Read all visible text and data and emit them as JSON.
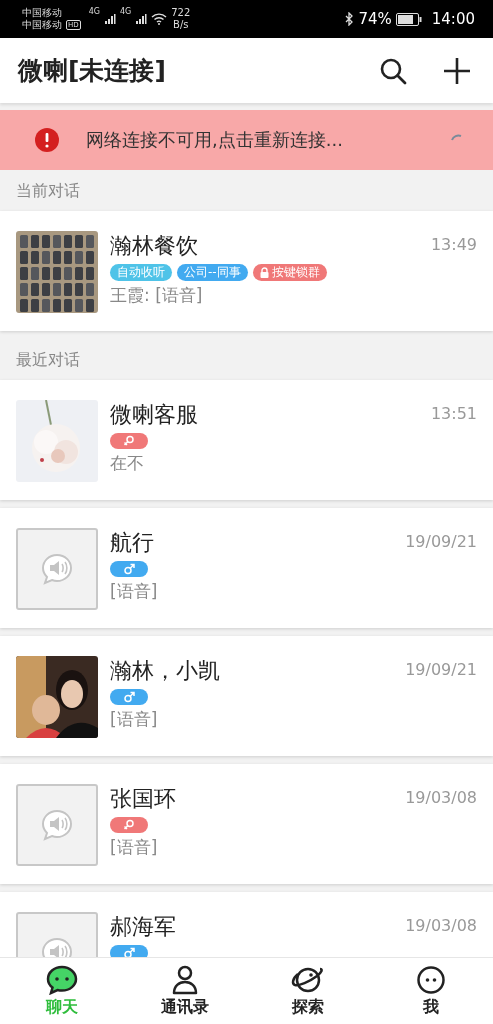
{
  "status_bar": {
    "carrier_1": "中国移动",
    "carrier_2": "中国移动",
    "hd": "HD",
    "network_1": "4G",
    "network_2": "4G",
    "speed_value": "722",
    "speed_unit": "B/s",
    "battery": "74%",
    "time": "14:00"
  },
  "header": {
    "title": "微喇[未连接]"
  },
  "alert": {
    "text": "网络连接不可用,点击重新连接..."
  },
  "sections": [
    {
      "title": "当前对话",
      "chats": [
        {
          "name": "瀚林餐饮",
          "time": "13:49",
          "avatar": {
            "kind": "picture"
          },
          "tags": [
            {
              "kind": "label",
              "text": "自动收听",
              "color": "#4fc3e8",
              "locked": false
            },
            {
              "kind": "label",
              "text": "公司--同事",
              "color": "#42aaf0",
              "locked": false
            },
            {
              "kind": "label",
              "text": "按键锁群",
              "color": "#f07878",
              "locked": true
            }
          ],
          "preview": "王霞: [语音]"
        }
      ]
    },
    {
      "title": "最近对话",
      "chats": [
        {
          "name": "微喇客服",
          "time": "13:51",
          "avatar": {
            "kind": "picture"
          },
          "tags": [
            {
              "kind": "female"
            }
          ],
          "preview": "在不"
        },
        {
          "name": "航行",
          "time": "19/09/21",
          "avatar": {
            "kind": "placeholder"
          },
          "tags": [
            {
              "kind": "male"
            }
          ],
          "preview": "[语音]"
        },
        {
          "name": "瀚林，小凯",
          "time": "19/09/21",
          "avatar": {
            "kind": "picture"
          },
          "tags": [
            {
              "kind": "male"
            }
          ],
          "preview": "[语音]"
        },
        {
          "name": "张国环",
          "time": "19/03/08",
          "avatar": {
            "kind": "placeholder"
          },
          "tags": [
            {
              "kind": "female"
            }
          ],
          "preview": "[语音]"
        },
        {
          "name": "郝海军",
          "time": "19/03/08",
          "avatar": {
            "kind": "placeholder"
          },
          "tags": [
            {
              "kind": "male"
            }
          ]
        }
      ]
    }
  ],
  "tabs": [
    {
      "label": "聊天",
      "selected": true
    },
    {
      "label": "通讯录",
      "selected": false
    },
    {
      "label": "探索",
      "selected": false
    },
    {
      "label": "我",
      "selected": false
    }
  ]
}
